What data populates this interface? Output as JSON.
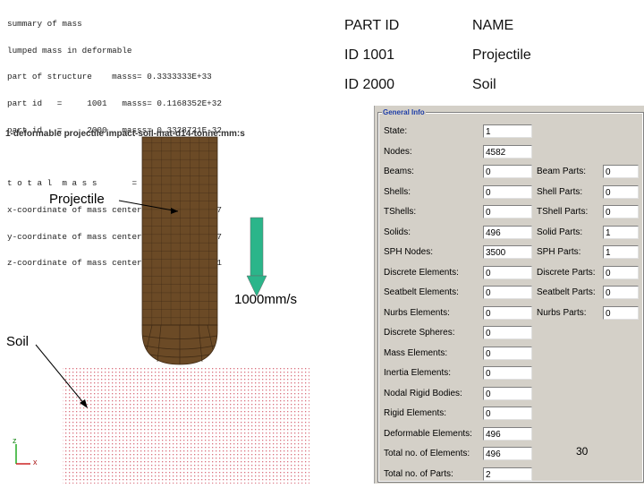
{
  "console": {
    "lines": [
      "summary of mass",
      "lumped mass in deformable",
      "part of structure    masss= 0.3333333E+33",
      "part id   =     1001   masss= 0.1168352E+32",
      "part id   =     2000   masss= 0.3328721E-32",
      "",
      "t o t a l  m a s s       = 0.1198970E+33",
      "x-coordinate of mass center = 0.3865223E-07",
      "y-coordinate of mass center =-0.7377778E+07",
      "z-coordinate of mass center = 0.7500000E+01"
    ]
  },
  "model_title": "1-deformable projectile impact-soil-mat-d14-tonne:mm:s",
  "part_table": {
    "headers": [
      "PART ID",
      "NAME"
    ],
    "rows": [
      [
        "ID 1001",
        "Projectile"
      ],
      [
        "ID 2000",
        "Soil"
      ]
    ]
  },
  "viewport": {
    "projectile_label": "Projectile",
    "soil_label": "Soil",
    "velocity_label": "1000mm/s",
    "axis_z": "z",
    "axis_x": "x",
    "arrow_color": "#2bb58a",
    "projectile_color": "#6b4a26",
    "soil_dot_color": "#d9707e"
  },
  "general_info": {
    "legend": "General Info",
    "left": [
      {
        "label": "State:",
        "value": "1"
      },
      {
        "label": "Nodes:",
        "value": "4582"
      },
      {
        "label": "Beams:",
        "value": "0"
      },
      {
        "label": "Shells:",
        "value": "0"
      },
      {
        "label": "TShells:",
        "value": "0"
      },
      {
        "label": "Solids:",
        "value": "496"
      },
      {
        "label": "SPH Nodes:",
        "value": "3500"
      },
      {
        "label": "Discrete Elements:",
        "value": "0"
      },
      {
        "label": "Seatbelt Elements:",
        "value": "0"
      },
      {
        "label": "Nurbs Elements:",
        "value": "0"
      },
      {
        "label": "Discrete Spheres:",
        "value": "0"
      },
      {
        "label": "Mass Elements:",
        "value": "0"
      },
      {
        "label": "Inertia Elements:",
        "value": "0"
      },
      {
        "label": "Nodal Rigid Bodies:",
        "value": "0"
      },
      {
        "label": "Rigid Elements:",
        "value": "0"
      },
      {
        "label": "Deformable Elements:",
        "value": "496"
      },
      {
        "label": "Total no. of Elements:",
        "value": "496"
      },
      {
        "label": "Total no. of Parts:",
        "value": "2"
      }
    ],
    "right": [
      {
        "label": "Beam Parts:",
        "value": "0"
      },
      {
        "label": "Shell Parts:",
        "value": "0"
      },
      {
        "label": "TShell Parts:",
        "value": "0"
      },
      {
        "label": "Solid Parts:",
        "value": "1"
      },
      {
        "label": "SPH Parts:",
        "value": "1"
      },
      {
        "label": "Discrete Parts:",
        "value": "0"
      },
      {
        "label": "Seatbelt Parts:",
        "value": "0"
      },
      {
        "label": "Nurbs Parts:",
        "value": "0"
      }
    ]
  },
  "page_number": "30"
}
